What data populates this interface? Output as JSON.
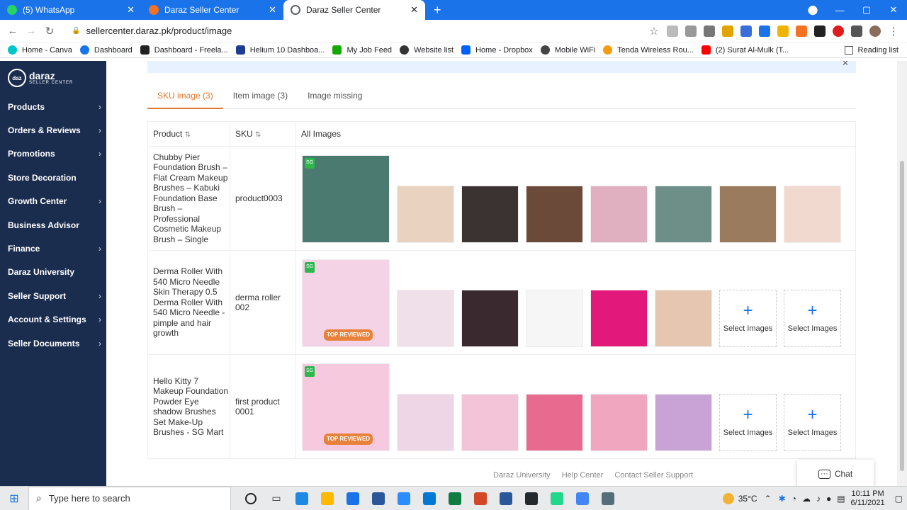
{
  "browser": {
    "tabs": [
      {
        "title": "(5) WhatsApp",
        "color": "#25d366"
      },
      {
        "title": "Daraz Seller Center",
        "color": "#f57224"
      },
      {
        "title": "Daraz Seller Center",
        "color": "#5f6368"
      }
    ],
    "url": "sellercenter.daraz.pk/product/image",
    "bookmarks": [
      {
        "label": "Home - Canva",
        "color": "#00c4cc"
      },
      {
        "label": "Dashboard",
        "color": "#1a73e8"
      },
      {
        "label": "Dashboard - Freela...",
        "color": "#222"
      },
      {
        "label": "Helium 10 Dashboa...",
        "color": "#1b3d8f"
      },
      {
        "label": "My Job Feed",
        "color": "#14a800"
      },
      {
        "label": "Website list",
        "color": "#333"
      },
      {
        "label": "Home - Dropbox",
        "color": "#0061ff"
      },
      {
        "label": "Mobile WiFi",
        "color": "#444"
      },
      {
        "label": "Tenda Wireless Rou...",
        "color": "#f39c12"
      },
      {
        "label": "(2) Surat Al-Mulk (T...",
        "color": "#ff0000"
      }
    ],
    "reading_list": "Reading list"
  },
  "sidebar": {
    "logo_main": "daraz",
    "logo_sub": "SELLER CENTER",
    "items": [
      {
        "label": "Products",
        "chevron": true
      },
      {
        "label": "Orders & Reviews",
        "chevron": true
      },
      {
        "label": "Promotions",
        "chevron": true
      },
      {
        "label": "Store Decoration",
        "chevron": false
      },
      {
        "label": "Growth Center",
        "chevron": true
      },
      {
        "label": "Business Advisor",
        "chevron": false
      },
      {
        "label": "Finance",
        "chevron": true
      },
      {
        "label": "Daraz University",
        "chevron": false
      },
      {
        "label": "Seller Support",
        "chevron": true
      },
      {
        "label": "Account & Settings",
        "chevron": true
      },
      {
        "label": "Seller Documents",
        "chevron": true
      }
    ]
  },
  "page_tabs": [
    {
      "label": "SKU image (3)",
      "active": true
    },
    {
      "label": "Item image (3)",
      "active": false
    },
    {
      "label": "Image missing",
      "active": false
    }
  ],
  "table": {
    "headers": {
      "product": "Product",
      "sku": "SKU",
      "images": "All Images"
    },
    "rows": [
      {
        "product": "Chubby Pier Foundation Brush – Flat Cream Makeup Brushes – Kabuki Foundation Base Brush – Professional Cosmetic Makeup Brush – Single",
        "sku": "product0003",
        "main_color": "#4a7a70",
        "thumbs": [
          "#e9d2c0",
          "#3b3232",
          "#6b4a3a",
          "#e0b0c0",
          "#6e8f88",
          "#9a7b5e",
          "#f2d9cf"
        ],
        "empty_slots": 0
      },
      {
        "product": "Derma Roller With 540 Micro Needle Skin Therapy 0.5 Derma Roller With 540 Micro Needle - pimple and hair growth",
        "sku": "derma roller 002",
        "main_color": "#f4d3e6",
        "thumbs": [
          "#f0e0ea",
          "#3a2a30",
          "#f6f6f6",
          "#e2197a",
          "#e6c6b0"
        ],
        "empty_slots": 2
      },
      {
        "product": "Hello Kitty 7 Makeup Foundation Powder Eye shadow Brushes Set Make-Up Brushes - SG Mart",
        "sku": "first product 0001",
        "main_color": "#f6c9df",
        "thumbs": [
          "#efd6e6",
          "#f3c3d8",
          "#e86a8e",
          "#f1a6c0",
          "#c9a3d6"
        ],
        "empty_slots": 2
      }
    ],
    "select_images_label": "Select Images",
    "fulfilled_badge": "SG",
    "top_reviewed_badge": "TOP REVIEWED"
  },
  "footer": {
    "links": [
      "Daraz University",
      "Help Center",
      "Contact Seller Support"
    ]
  },
  "chat": {
    "label": "Chat"
  },
  "taskbar": {
    "search_placeholder": "Type here to search",
    "temperature": "35°C",
    "time": "10:11 PM",
    "date": "6/11/2021",
    "apps": [
      "#1e88e5",
      "#ffb900",
      "#1a73e8",
      "#2b579a",
      "#2d8cff",
      "#0078d4",
      "#107c41",
      "#d24726",
      "#2b579a",
      "#24292e",
      "#21d789",
      "#4285f4",
      "#546e7a"
    ]
  }
}
